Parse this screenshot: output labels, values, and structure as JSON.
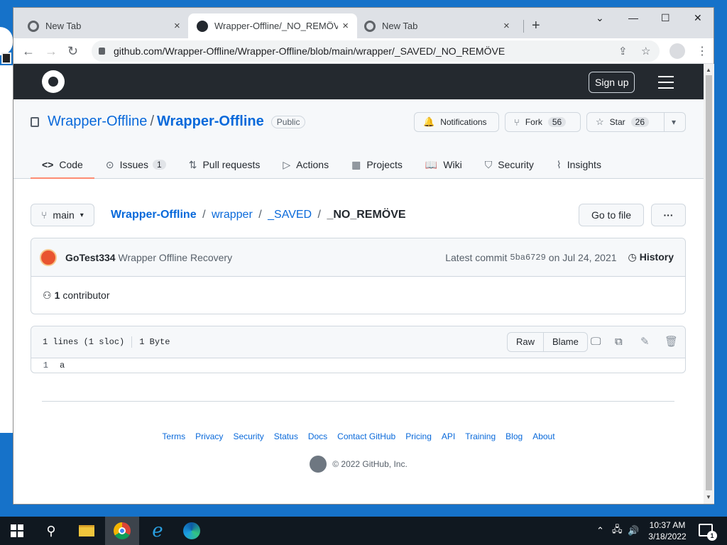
{
  "browser": {
    "tabs": [
      {
        "title": "New Tab",
        "close": "×"
      },
      {
        "title": "Wrapper-Offline/_NO_REMÖVE a",
        "close": "×"
      },
      {
        "title": "New Tab",
        "close": "×"
      }
    ],
    "new_tab_label": "+",
    "window_controls": {
      "dropdown": "⌄",
      "minimize": "—",
      "maximize": "☐",
      "close": "✕"
    },
    "url": "github.com/Wrapper-Offline/Wrapper-Offline/blob/main/wrapper/_SAVED/_NO_REMÖVE",
    "nav": {
      "back": "←",
      "forward": "→",
      "reload": "↻"
    },
    "share_icon": "⇪",
    "star_icon": "☆",
    "menu_icon": "⋮"
  },
  "header": {
    "signup_label": "Sign up"
  },
  "repo": {
    "owner": "Wrapper-Offline",
    "slash": "/",
    "name": "Wrapper-Offline",
    "visibility": "Public",
    "notifications_label": "Notifications",
    "fork_label": "Fork",
    "fork_count": "56",
    "star_label": "Star",
    "star_count": "26",
    "star_dropdown": "▾",
    "nav": [
      {
        "label": "Code",
        "icon": "<>"
      },
      {
        "label": "Issues",
        "icon": "⊙",
        "count": "1"
      },
      {
        "label": "Pull requests",
        "icon": "⇅"
      },
      {
        "label": "Actions",
        "icon": "▷"
      },
      {
        "label": "Projects",
        "icon": "▦"
      },
      {
        "label": "Wiki",
        "icon": "📖"
      },
      {
        "label": "Security",
        "icon": "⛉"
      },
      {
        "label": "Insights",
        "icon": "⌇"
      }
    ]
  },
  "breadcrumb": {
    "branch": "main",
    "branch_caret": "▾",
    "root": "Wrapper-Offline",
    "slash": "/",
    "parts": [
      "wrapper",
      "_SAVED"
    ],
    "current": "_NO_REMÖVE",
    "go_to_file": "Go to file",
    "more": "···"
  },
  "commit": {
    "author": "GoTest334",
    "message": "Wrapper Offline Recovery",
    "latest_label": "Latest commit",
    "sha": "5ba6729",
    "date": "on Jul 24, 2021",
    "history_label": "History",
    "history_icon": "◷",
    "contributors_count": "1",
    "contributors_label": "contributor",
    "contributors_icon": "⚇"
  },
  "file": {
    "lines_info": "1 lines (1 sloc)",
    "size": "1 Byte",
    "raw_label": "Raw",
    "blame_label": "Blame",
    "desktop_icon": "🖵",
    "copy_icon": "⧉",
    "edit_icon": "✎",
    "delete_icon": "🗑",
    "code": [
      {
        "number": "1",
        "text": "a"
      }
    ]
  },
  "footer": {
    "links": [
      "Terms",
      "Privacy",
      "Security",
      "Status",
      "Docs",
      "Contact GitHub",
      "Pricing",
      "API",
      "Training",
      "Blog",
      "About"
    ],
    "copyright": "© 2022 GitHub, Inc."
  },
  "taskbar": {
    "search_icon": "⚲",
    "tray_chevron": "⌃",
    "tray_network": "🖧",
    "tray_volume": "🔊",
    "time": "10:37 AM",
    "date": "3/18/2022",
    "notification_count": "1"
  }
}
